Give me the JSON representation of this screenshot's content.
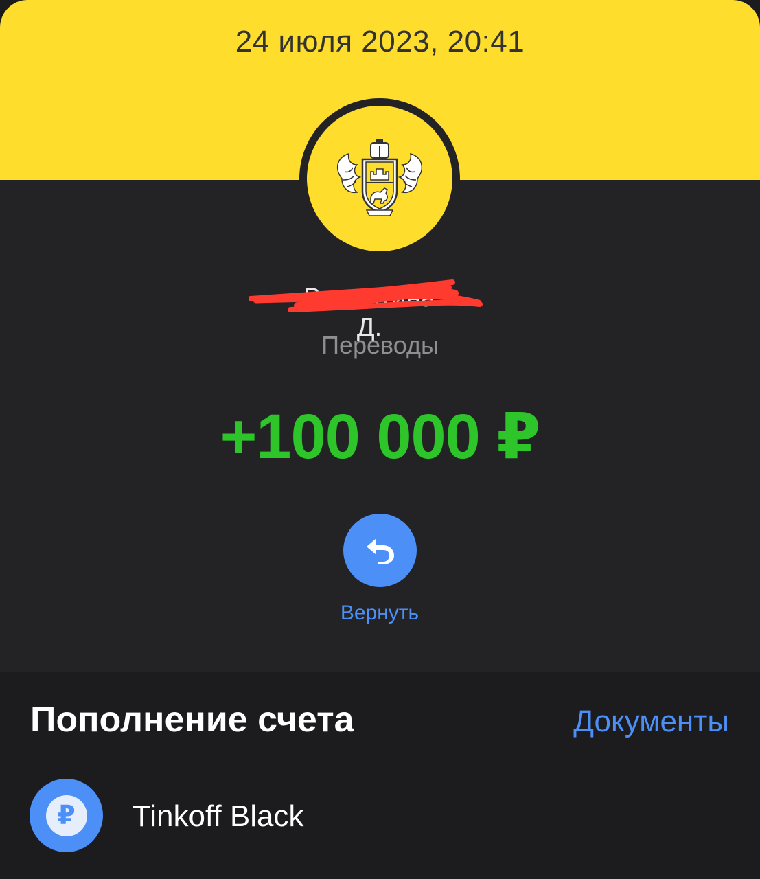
{
  "header": {
    "datetime": "24 июля 2023, 20:41"
  },
  "operation": {
    "sender_name": "Валентина Д.",
    "sender_redacted": true,
    "category": "Переводы",
    "amount": "+100 000 ₽",
    "bank_logo_icon": "tinkoff-bank-logo"
  },
  "actions": {
    "return_label": "Вернуть",
    "return_icon": "return-arrow-icon"
  },
  "details": {
    "section_title": "Пополнение счета",
    "documents_link": "Документы",
    "account": {
      "name": "Tinkoff Black",
      "icon": "ruble-icon",
      "currency_symbol": "₽"
    }
  },
  "colors": {
    "brand_yellow": "#ffdd2d",
    "card_background": "#232326",
    "page_background": "#1c1c1e",
    "amount_green": "#2ec52b",
    "accent_blue": "#4b8ff7",
    "muted_text": "#8e8e93",
    "redaction_red": "#ff3b30"
  }
}
